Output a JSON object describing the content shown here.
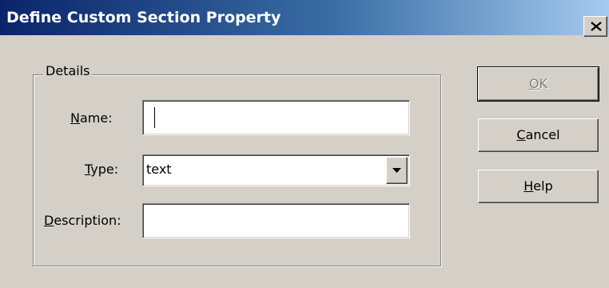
{
  "window": {
    "title": "Define Custom Section Property",
    "close_icon": "close-icon"
  },
  "details": {
    "group_label": "Details",
    "name": {
      "label_mnemonic": "N",
      "label_rest": "ame:",
      "value": ""
    },
    "type": {
      "label_mnemonic": "T",
      "label_rest": "ype:",
      "value": "text",
      "icon": "chevron-down-icon"
    },
    "description": {
      "label_mnemonic": "D",
      "label_rest": "escription:",
      "value": ""
    }
  },
  "buttons": {
    "ok": {
      "mnemonic": "O",
      "rest": "K",
      "enabled": false
    },
    "cancel": {
      "mnemonic": "C",
      "rest": "ancel",
      "enabled": true
    },
    "help": {
      "mnemonic": "H",
      "rest": "elp",
      "enabled": true
    }
  },
  "colors": {
    "titlebar_start": "#0a246a",
    "titlebar_end": "#a6caf0",
    "face": "#d4d0c8"
  }
}
